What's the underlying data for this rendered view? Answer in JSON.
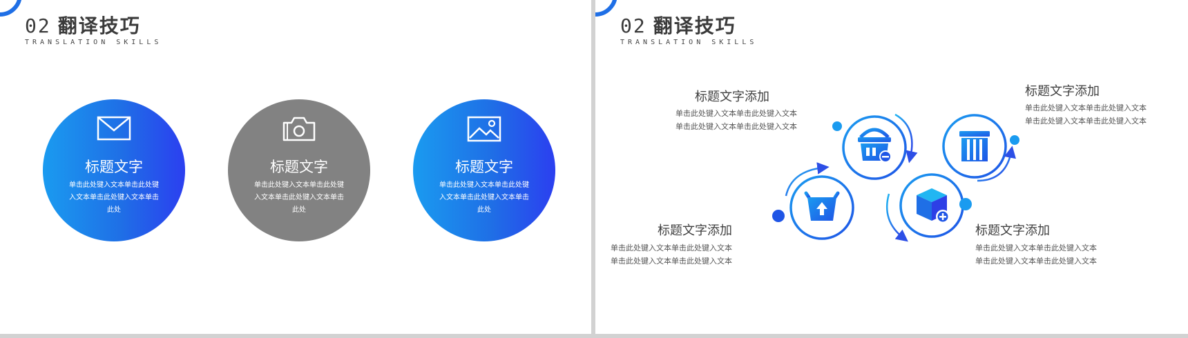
{
  "slides": [
    {
      "header": {
        "num": "02",
        "title": "翻译技巧",
        "subtitle": "TRANSLATION SKILLS"
      },
      "circles": [
        {
          "icon": "mail-icon",
          "title": "标题文字",
          "body": "单击此处键入文本单击此处键入文本单击此处键入文本单击此处"
        },
        {
          "icon": "camera-icon",
          "title": "标题文字",
          "body": "单击此处键入文本单击此处键入文本单击此处键入文本单击此处"
        },
        {
          "icon": "image-icon",
          "title": "标题文字",
          "body": "单击此处键入文本单击此处键入文本单击此处键入文本单击此处"
        }
      ]
    },
    {
      "header": {
        "num": "02",
        "title": "翻译技巧",
        "subtitle": "TRANSLATION SKILLS"
      },
      "items": [
        {
          "title": "标题文字添加",
          "body": "单击此处键入文本单击此处键入文本单击此处键入文本单击此处键入文本",
          "icon": "basket-minus-icon"
        },
        {
          "title": "标题文字添加",
          "body": "单击此处键入文本单击此处键入文本单击此处键入文本单击此处键入文本",
          "icon": "store-icon"
        },
        {
          "title": "标题文字添加",
          "body": "单击此处键入文本单击此处键入文本单击此处键入文本单击此处键入文本",
          "icon": "basket-upload-icon"
        },
        {
          "title": "标题文字添加",
          "body": "单击此处键入文本单击此处键入文本单击此处键入文本单击此处键入文本",
          "icon": "box-add-icon"
        }
      ]
    }
  ],
  "colors": {
    "accent": "#1f6fe6",
    "accent_light": "#1a9bf0",
    "gray": "#828282"
  }
}
